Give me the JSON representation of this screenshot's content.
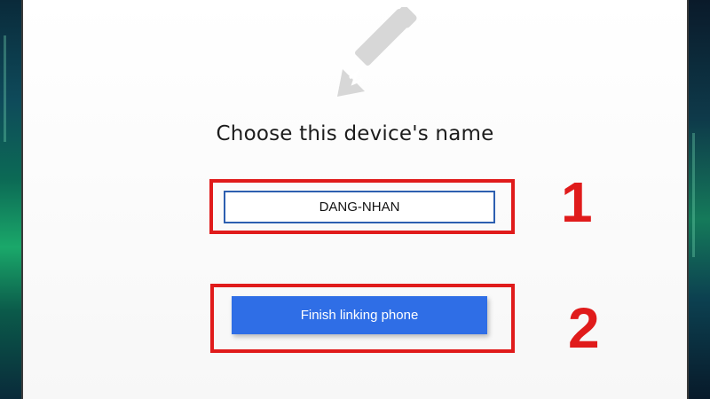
{
  "dialog": {
    "title": "Choose this device's name",
    "device_name_value": "DANG-NHAN",
    "finish_button_label": "Finish linking phone"
  },
  "icons": {
    "header_icon": "pencil-icon"
  },
  "annotations": {
    "step_1": "1",
    "step_2": "2"
  },
  "colors": {
    "button": "#2f6ee6",
    "callout": "#e01b1b",
    "input_border": "#2d5fb0"
  }
}
